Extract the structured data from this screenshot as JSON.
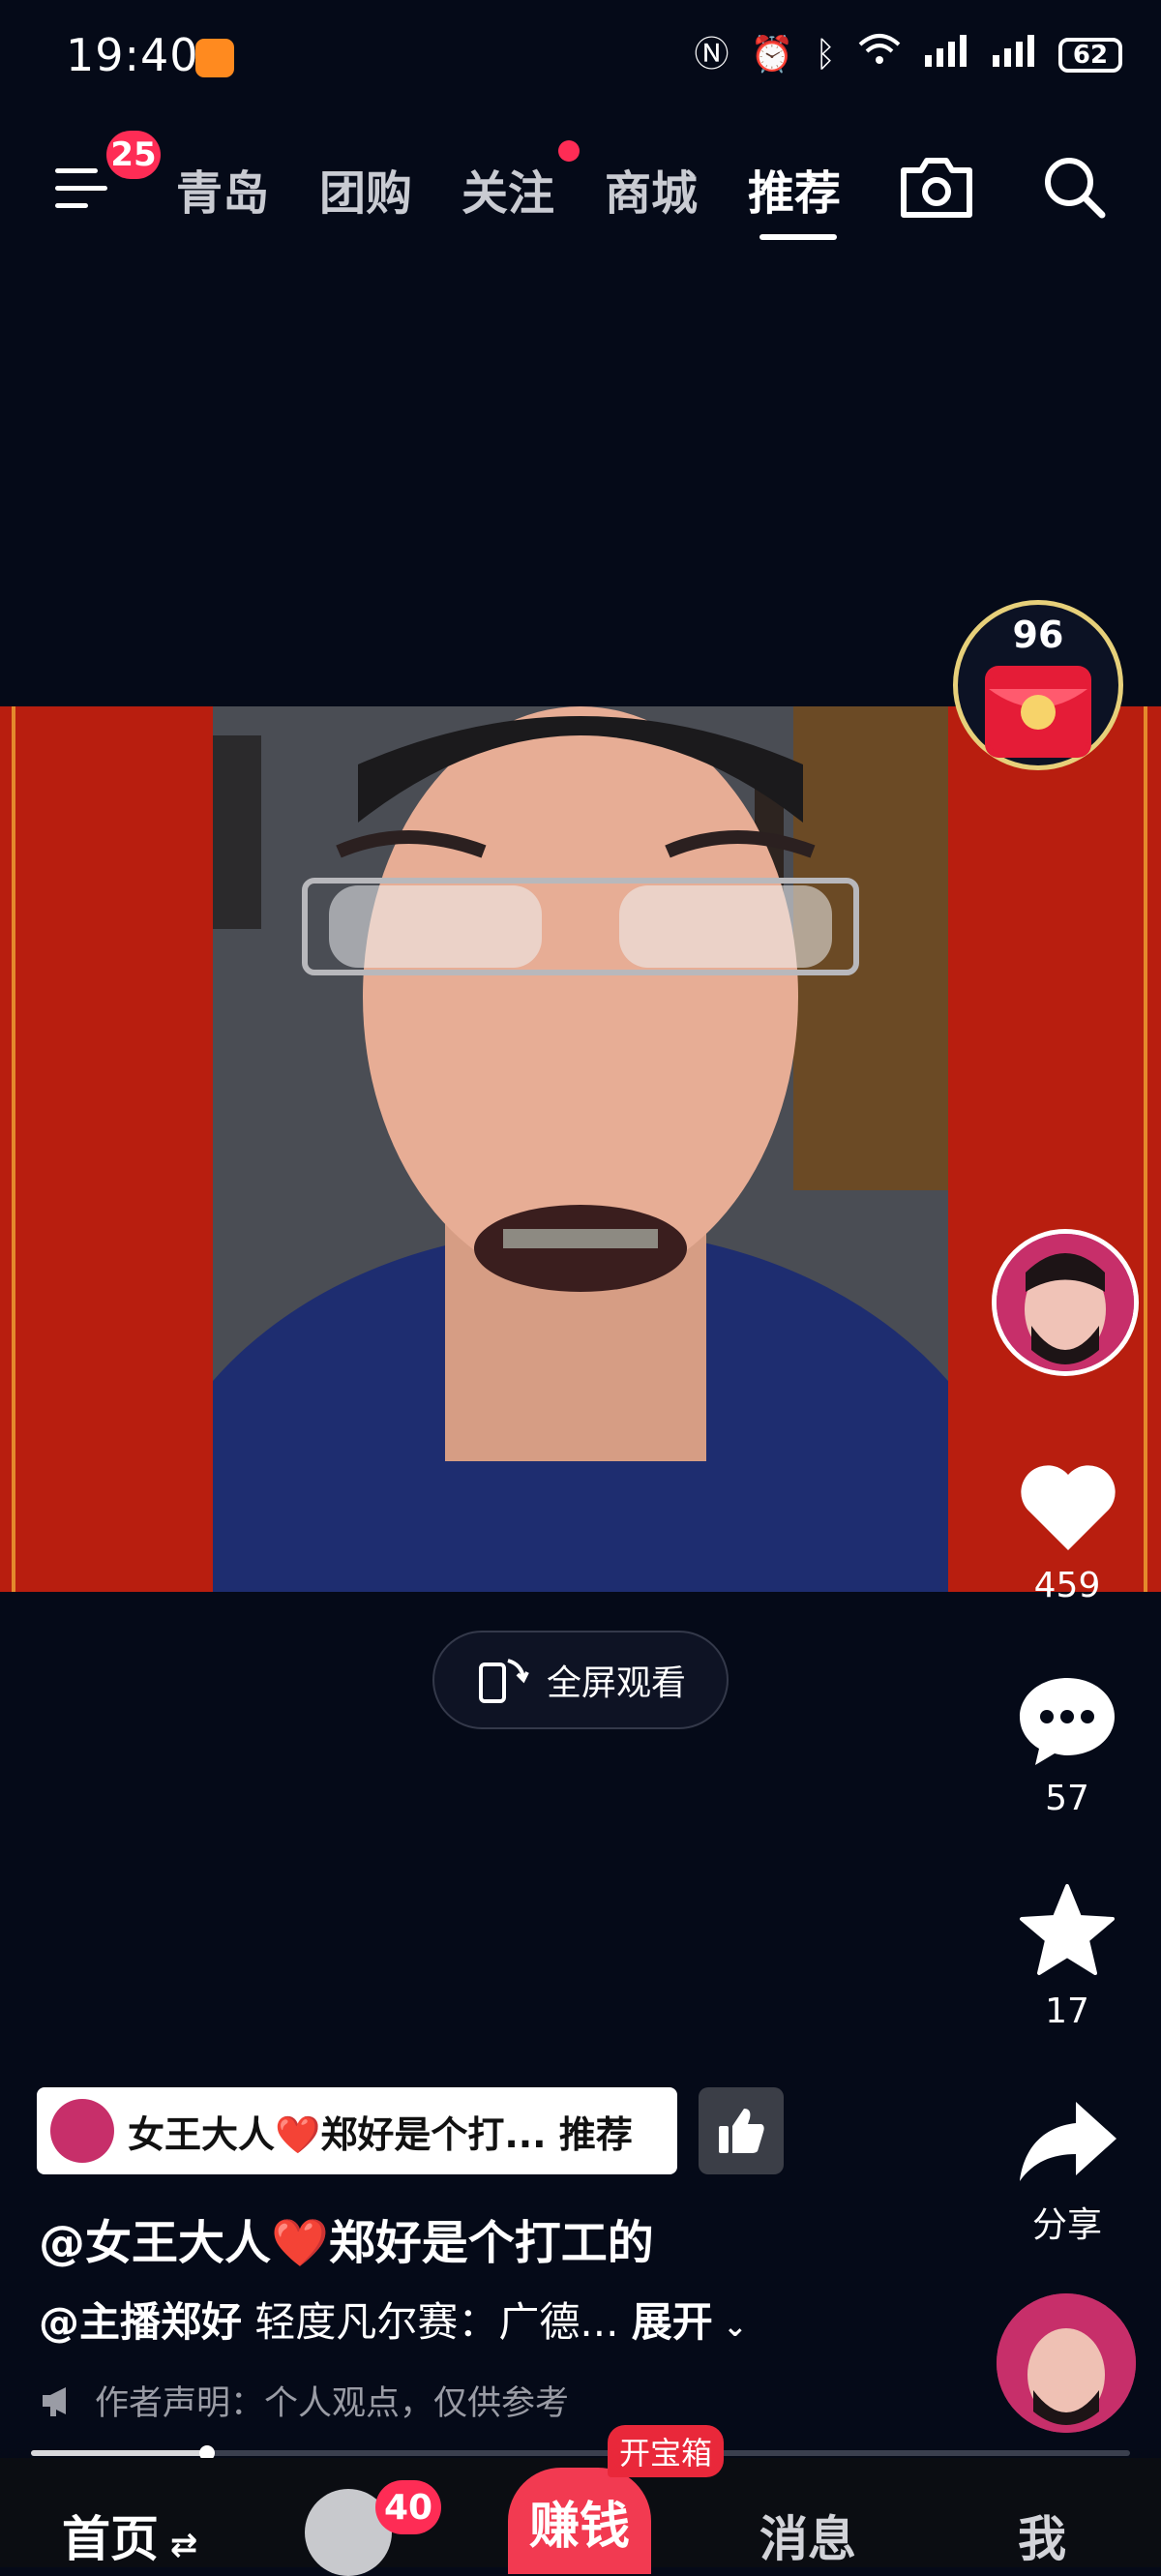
{
  "status_bar": {
    "time": "19:40",
    "battery": "62"
  },
  "nav": {
    "menu_badge": "25",
    "tabs": [
      {
        "label": "青岛"
      },
      {
        "label": "团购"
      },
      {
        "label": "关注"
      },
      {
        "label": "商城"
      },
      {
        "label": "推荐"
      }
    ],
    "active_tab": "推荐"
  },
  "reward": {
    "count": "96"
  },
  "video": {
    "fullscreen_label": "全屏观看"
  },
  "actions": {
    "likes": "459",
    "comments": "57",
    "favorites": "17",
    "share": "分享"
  },
  "info": {
    "recommend_chip": "女王大人❤️郑好是个打... 推荐",
    "author": "@女王大人❤️郑好是个打工的",
    "mention": "@主播郑好",
    "desc": "轻度凡尔赛：广德...",
    "expand": "展开",
    "declaration": "作者声明：个人观点，仅供参考",
    "progress": 0.16
  },
  "bottom_nav": {
    "home": "首页",
    "friend_badge": "40",
    "earn": "赚钱",
    "earn_tag": "开宝箱",
    "messages": "消息",
    "me": "我"
  },
  "colors": {
    "accent": "#fe2c55",
    "video_bg": "#b81e0f",
    "page_bg": "#050a18"
  }
}
